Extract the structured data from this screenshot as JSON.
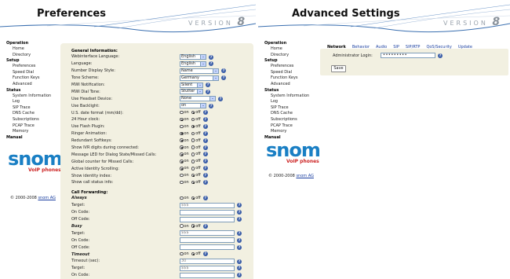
{
  "left": {
    "title": "Preferences",
    "version_word": "VERSION",
    "version_num": "8",
    "nav": [
      {
        "section": "Operation",
        "items": [
          "Home",
          "Directory"
        ]
      },
      {
        "section": "Setup",
        "items": [
          "Preferences",
          "Speed Dial",
          "Function Keys",
          "Advanced"
        ]
      },
      {
        "section": "Status",
        "items": [
          "System Information",
          "Log",
          "SIP Trace",
          "DNS Cache",
          "Subscriptions",
          "PCAP Trace",
          "Memory"
        ]
      },
      {
        "section": "Manual",
        "items": []
      }
    ],
    "logo_text": "snom",
    "logo_tag": "VoIP phones",
    "copyright_text": "© 2000-2008 ",
    "copyright_link": "snom AG",
    "general": {
      "title": "General Information:",
      "rows": [
        {
          "label": "Webinterface Language:",
          "type": "select",
          "value": "English",
          "w": 34
        },
        {
          "label": "Language:",
          "type": "select",
          "value": "English",
          "w": 34
        },
        {
          "label": "Number Display Style:",
          "type": "select",
          "value": "Name",
          "w": 50
        },
        {
          "label": "Tone Scheme:",
          "type": "select",
          "value": "Germany",
          "w": 50
        },
        {
          "label": "MWI Notification:",
          "type": "select",
          "value": "Silent",
          "w": 30
        },
        {
          "label": "MWI Dial Tone:",
          "type": "select",
          "value": "Stutter",
          "w": 30
        },
        {
          "label": "Use Headset Device:",
          "type": "select",
          "value": "None",
          "w": 46
        },
        {
          "label": "Use Backlight:",
          "type": "select",
          "value": "on",
          "w": 34
        },
        {
          "label": "U.S. date format (mm/dd):",
          "type": "radio",
          "value": "off"
        },
        {
          "label": "24 Hour clock:",
          "type": "radio",
          "value": "on"
        },
        {
          "label": "Use Flash Plugin:",
          "type": "radio",
          "value": "off"
        },
        {
          "label": "Ringer Animation:",
          "type": "radio",
          "value": "on"
        },
        {
          "label": "Redundant Softkeys:",
          "type": "radio",
          "value": "on"
        },
        {
          "label": "Show IVR digits during connected:",
          "type": "radio",
          "value": "on"
        },
        {
          "label": "Message LED for Dialog State/Missed Calls:",
          "type": "radio",
          "value": "on"
        },
        {
          "label": "Global counter for Missed Calls:",
          "type": "radio",
          "value": "on"
        },
        {
          "label": "Active Identity Scrolling:",
          "type": "radio",
          "value": "on"
        },
        {
          "label": "Show identity index:",
          "type": "radio",
          "value": "off"
        },
        {
          "label": "Show call status info:",
          "type": "radio",
          "value": "off"
        }
      ]
    },
    "forwarding": {
      "title": "Call Forwarding:",
      "groups": [
        {
          "name": "Always",
          "state": "off",
          "rows": [
            {
              "label": "Target:",
              "value": "$$$"
            },
            {
              "label": "On Code:",
              "value": ""
            },
            {
              "label": "Off Code:",
              "value": ""
            }
          ]
        },
        {
          "name": "Busy",
          "state": "off",
          "rows": [
            {
              "label": "Target:",
              "value": "$$$"
            },
            {
              "label": "On Code:",
              "value": ""
            },
            {
              "label": "Off Code:",
              "value": ""
            }
          ]
        },
        {
          "name": "Timeout",
          "state": "off",
          "rows": [
            {
              "label": "Timeout (sec):",
              "value": "30"
            },
            {
              "label": "Target:",
              "value": "$$$"
            },
            {
              "label": "On Code:",
              "value": ""
            },
            {
              "label": "Off Code:",
              "value": ""
            }
          ]
        }
      ]
    },
    "radio_on": "on",
    "radio_off": "off"
  },
  "right": {
    "title": "Advanced Settings",
    "version_word": "VERSION",
    "version_num": "8",
    "tabs": [
      "Network",
      "Behavior",
      "Audio",
      "SIP",
      "SIP/RTP",
      "QoS/Security",
      "Update"
    ],
    "login_label": "Administrator Login:",
    "login_value": "•••••••••",
    "save_label": "Save",
    "copyright_text": "© 2000-2008 ",
    "copyright_link": "snom AG"
  },
  "colors": {
    "accent": "#1a7fc4",
    "box": "#f2f0e1",
    "help": "#3b5ea8"
  }
}
